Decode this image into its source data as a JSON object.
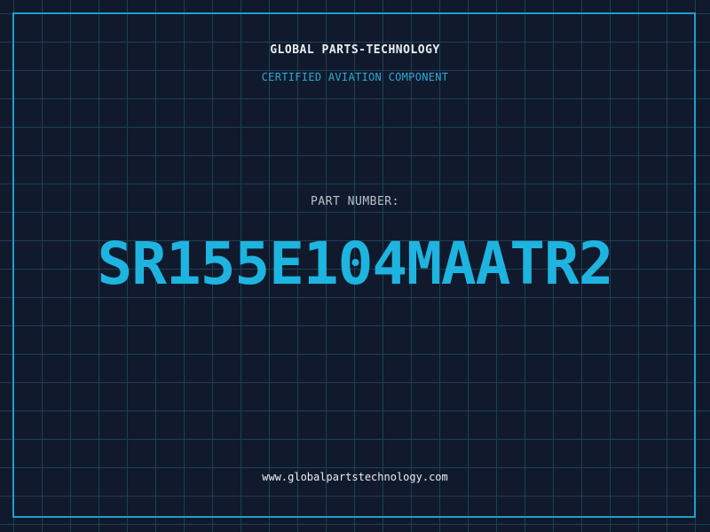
{
  "header": {
    "company": "GLOBAL PARTS-TECHNOLOGY",
    "tagline": "CERTIFIED AVIATION COMPONENT"
  },
  "part": {
    "label": "PART NUMBER:",
    "number": "SR155E104MAATR2"
  },
  "footer": {
    "website": "www.globalpartstechnology.com"
  },
  "colors": {
    "background": "#101a2c",
    "grid": "#1f3f55",
    "accent": "#1eb4e0",
    "frame": "#1e9fc8",
    "text": "#e8eef2"
  }
}
